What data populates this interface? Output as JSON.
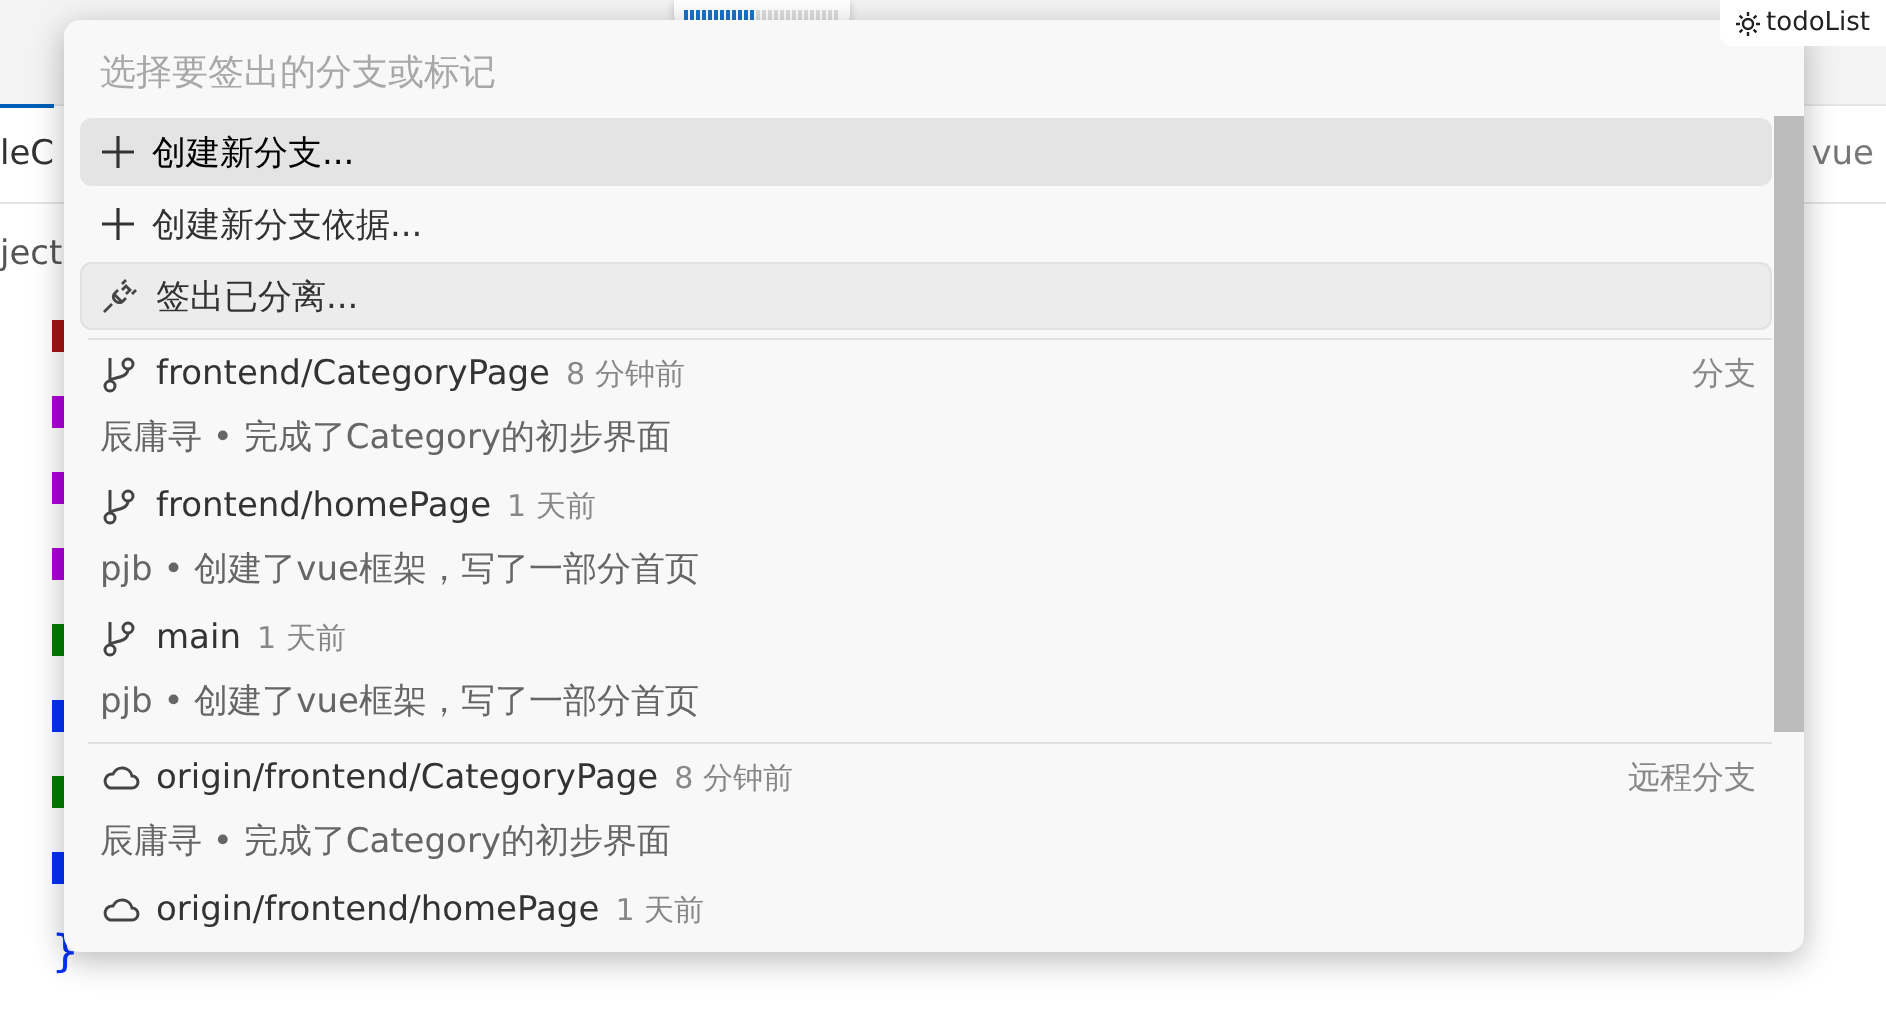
{
  "title_bar": {
    "workspace": "todoList",
    "progress": {
      "level": 0.45
    }
  },
  "editor": {
    "tab_left": "leC",
    "tab_right": "vue",
    "breadcrumb": "ject",
    "closing_brace": "}"
  },
  "quick_pick": {
    "placeholder": "选择要签出的分支或标记",
    "actions": [
      {
        "kind": "plus",
        "label": "创建新分支...",
        "selected": true,
        "hovered": false
      },
      {
        "kind": "plus",
        "label": "创建新分支依据...",
        "selected": false,
        "hovered": false
      },
      {
        "kind": "detach",
        "label": "签出已分离...",
        "selected": false,
        "hovered": true
      }
    ],
    "groups": [
      {
        "label": "分支",
        "kind": "local",
        "items": [
          {
            "name": "frontend/CategoryPage",
            "time": "8 分钟前",
            "detail": "辰庸寻 • 完成了Category的初步界面",
            "selected": false
          },
          {
            "name": "frontend/homePage",
            "time": "1 天前",
            "detail": "pjb • 创建了vue框架，写了一部分首页",
            "selected": false
          },
          {
            "name": "main",
            "time": "1 天前",
            "detail": "pjb • 创建了vue框架，写了一部分首页",
            "selected": false
          }
        ]
      },
      {
        "label": "远程分支",
        "kind": "remote",
        "items": [
          {
            "name": "origin/frontend/CategoryPage",
            "time": "8 分钟前",
            "detail": "辰庸寻 • 完成了Category的初步界面",
            "selected": false
          },
          {
            "name": "origin/frontend/homePage",
            "time": "1 天前",
            "selected": false
          }
        ]
      }
    ]
  }
}
